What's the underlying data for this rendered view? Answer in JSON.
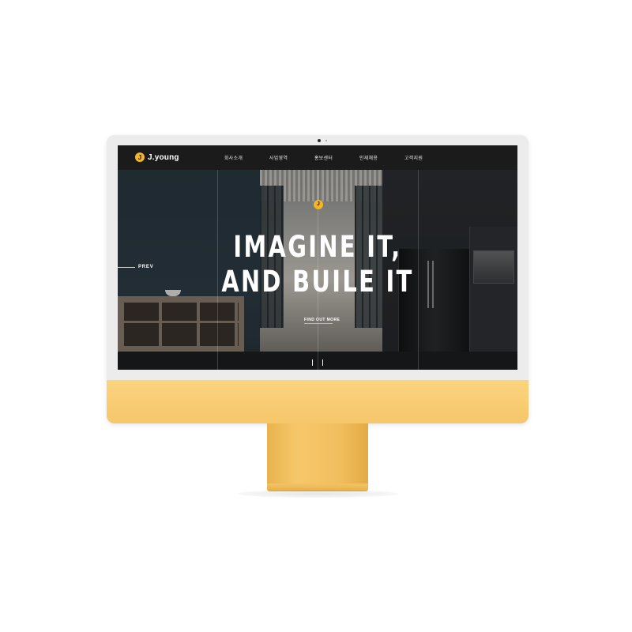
{
  "site": {
    "logo_text": "J.young",
    "logo_mark": "J"
  },
  "nav": {
    "items": [
      {
        "label": "회사소개"
      },
      {
        "label": "사업영역"
      },
      {
        "label": "홍보센터"
      },
      {
        "label": "인재채용"
      },
      {
        "label": "고객지원"
      }
    ]
  },
  "hero": {
    "badge_mark": "J",
    "headline_line1": "IMAGINE IT,",
    "headline_line2": "AND BUILE IT",
    "cta_label": "FIND OUT MORE",
    "prev_label": "PREV",
    "slide_count": 2
  },
  "colors": {
    "accent": "#f4b526",
    "navbar": "#1b1b1b",
    "chin": "#f6c66a"
  }
}
